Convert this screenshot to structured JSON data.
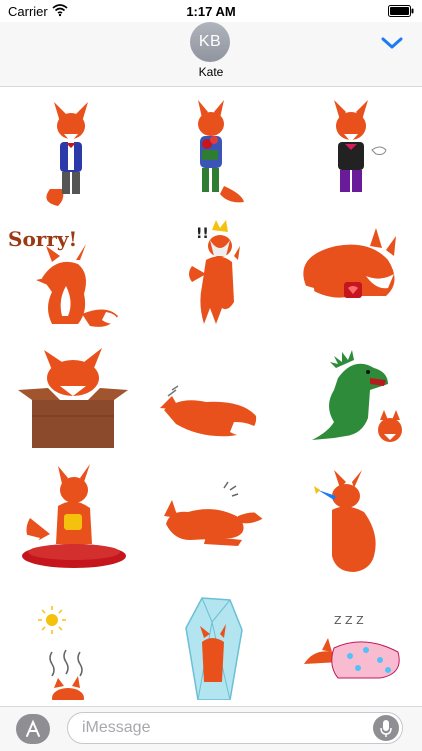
{
  "status_bar": {
    "carrier": "Carrier",
    "time": "1:17 AM"
  },
  "header": {
    "avatar_initials": "KB",
    "contact_name": "Kate",
    "collapse_icon": "chevron-down-icon"
  },
  "stickers": [
    {
      "name": "fox-in-suit"
    },
    {
      "name": "fox-with-flowers"
    },
    {
      "name": "fox-in-tuxedo"
    },
    {
      "name": "fox-sorry",
      "text": "Sorry!"
    },
    {
      "name": "fox-with-crown",
      "text": "!!"
    },
    {
      "name": "fox-crouching-heart"
    },
    {
      "name": "fox-in-box"
    },
    {
      "name": "fox-sleeping"
    },
    {
      "name": "fox-with-dinosaur"
    },
    {
      "name": "fox-on-cushion"
    },
    {
      "name": "fox-lying-down"
    },
    {
      "name": "fox-party-horn"
    },
    {
      "name": "fox-hot-sun"
    },
    {
      "name": "fox-in-ice"
    },
    {
      "name": "fox-under-blanket",
      "text": "Z Z Z"
    }
  ],
  "compose": {
    "placeholder": "iMessage",
    "apps_icon": "app-store-icon",
    "mic_icon": "microphone-icon"
  },
  "colors": {
    "fox": "#e8511b",
    "accent": "#1a7cf5",
    "avatar": "#9da1a9"
  }
}
